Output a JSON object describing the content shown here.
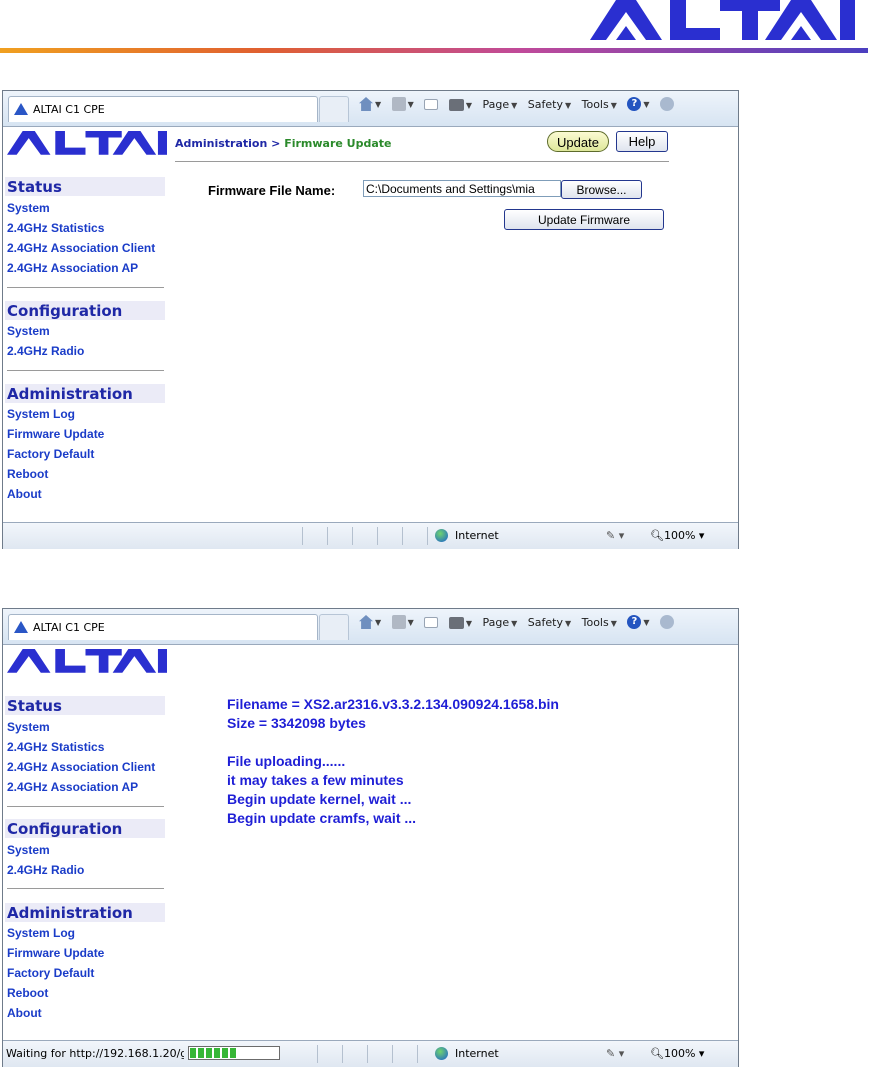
{
  "brand": {
    "logo_text": "ALTAI",
    "accent": "#1f28a6"
  },
  "browser": {
    "tab_title": "ALTAI C1 CPE",
    "command_bar": {
      "page": "Page",
      "safety": "Safety",
      "tools": "Tools"
    },
    "status": {
      "zone": "Internet",
      "zoom": "100%"
    }
  },
  "sidebar": {
    "status": {
      "heading": "Status",
      "items": [
        "System",
        "2.4GHz Statistics",
        "2.4GHz Association Client",
        "2.4GHz Association AP"
      ]
    },
    "configuration": {
      "heading": "Configuration",
      "items": [
        "System",
        "2.4GHz Radio"
      ]
    },
    "administration": {
      "heading": "Administration",
      "items": [
        "System Log",
        "Firmware Update",
        "Factory Default",
        "Reboot",
        "About"
      ]
    }
  },
  "screen1": {
    "breadcrumb": {
      "section": "Administration",
      "separator": " > ",
      "page": "Firmware Update"
    },
    "buttons": {
      "update": "Update",
      "help": "Help"
    },
    "form": {
      "label": "Firmware File Name:",
      "file_value": "C:\\Documents and Settings\\mia",
      "browse": "Browse...",
      "submit": "Update Firmware"
    }
  },
  "screen2": {
    "messages": [
      "Filename = XS2.ar2316.v3.3.2.134.090924.1658.bin",
      "Size = 3342098 bytes",
      "File uploading......",
      "it may takes a few minutes",
      "Begin update kernel, wait ...",
      "Begin update cramfs, wait ..."
    ],
    "status_text": "Waiting for http://192.168.1.20/gc",
    "progress": 0.55
  }
}
